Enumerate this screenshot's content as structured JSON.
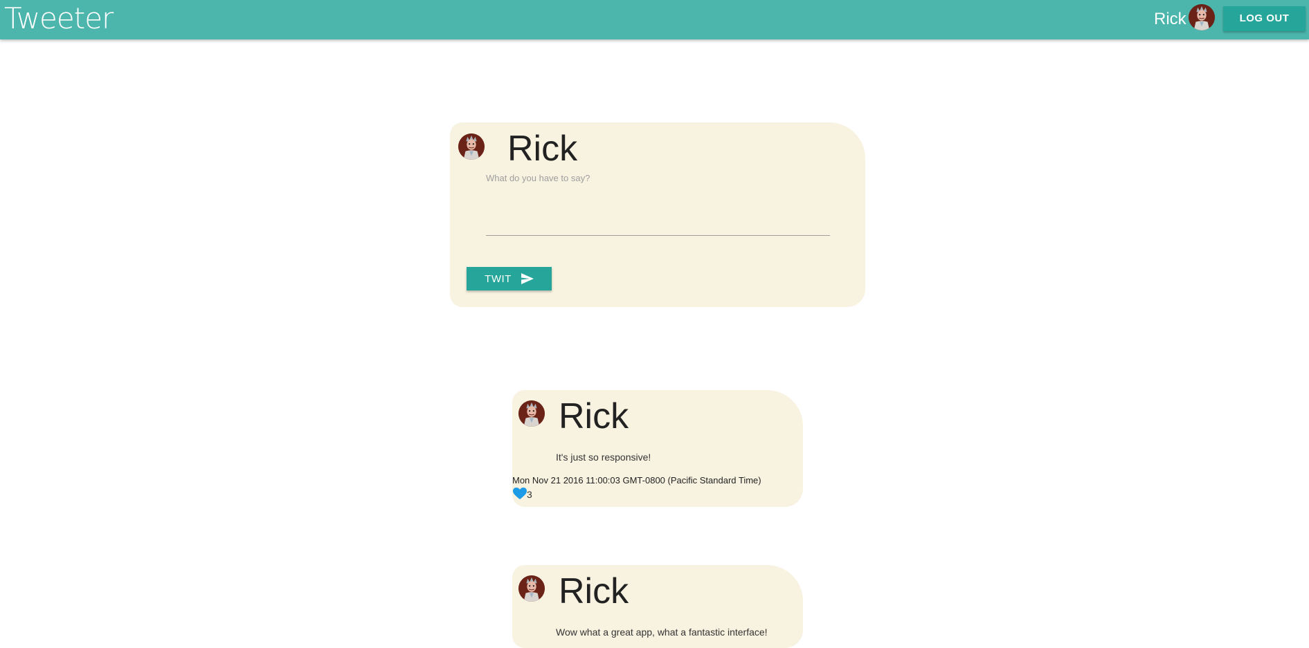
{
  "header": {
    "brand": "Tweeter",
    "user_name": "Rick",
    "avatar_icon": "user-avatar",
    "logout_label": "LOG OUT",
    "color": "#4db6ac"
  },
  "composer": {
    "user_name": "Rick",
    "placeholder": "What do you have to say?",
    "submit_label": "TWIT",
    "submit_icon": "send-icon"
  },
  "tweets": [
    {
      "user_name": "Rick",
      "text": "It's just so responsive!",
      "timestamp": "Mon Nov 21 2016 11:00:03 GMT-0800 (Pacific Standard Time)",
      "like_icon": "heart-icon",
      "likes": "3"
    },
    {
      "user_name": "Rick",
      "text": "Wow what a great app, what a fantastic interface!"
    }
  ],
  "colors": {
    "accent": "#26a69a",
    "card_background": "#f8f2e0",
    "heart": "#1e9be6"
  }
}
